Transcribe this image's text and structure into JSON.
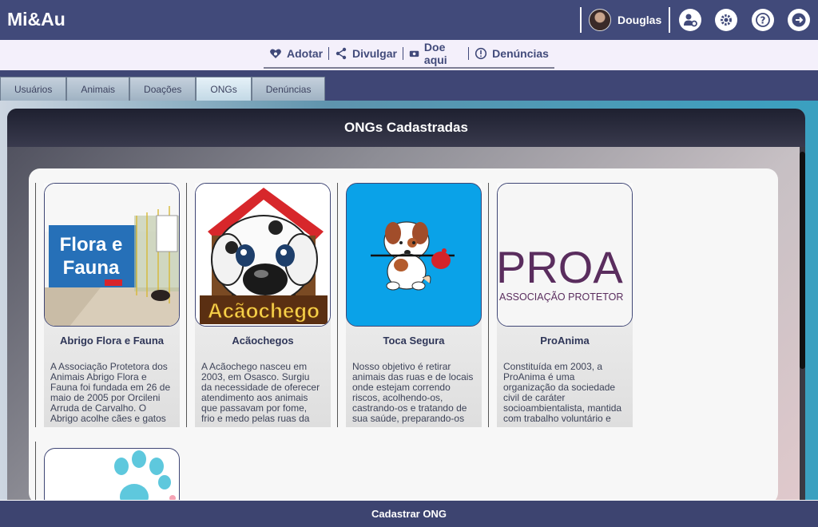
{
  "app": {
    "brand": "Mi&Au"
  },
  "user": {
    "name": "Douglas"
  },
  "header_icons": [
    "user-settings-icon",
    "gear-icon",
    "help-icon",
    "logout-icon"
  ],
  "nav": {
    "items": [
      {
        "label": "Adotar",
        "icon": "heart-paw-icon"
      },
      {
        "label": "Divulgar",
        "icon": "share-icon"
      },
      {
        "label": "Doe aqui",
        "icon": "money-icon"
      },
      {
        "label": "Denúncias",
        "icon": "alert-icon"
      }
    ]
  },
  "tabs": [
    {
      "label": "Usuários"
    },
    {
      "label": "Animais"
    },
    {
      "label": "Doações"
    },
    {
      "label": "ONGs",
      "active": true
    },
    {
      "label": "Denúncias"
    }
  ],
  "panel": {
    "title": "ONGs Cadastradas"
  },
  "ongs": [
    {
      "name": "Abrigo Flora e Fauna",
      "image_text": "Flora e Fauna",
      "description": "A Associação Protetora dos Animais Abrigo Flora e Fauna foi fundada em 26 de maio de 2005 por Orcileni Arruda de Carvalho. O Abrigo acolhe cães e gatos"
    },
    {
      "name": "Acãochegos",
      "image_text": "Acãochego",
      "description": "A Acãochego nasceu em 2003, em Osasco. Surgiu da necessidade de oferecer atendimento aos animais que passavam por fome, frio e medo pelas ruas da"
    },
    {
      "name": "Toca Segura",
      "image_text": "",
      "description": "Nosso objetivo é retirar animais das ruas e de locais onde estejam correndo riscos, acolhendo-os, castrando-os e tratando de sua saúde, preparando-os"
    },
    {
      "name": "ProAnima",
      "image_text": "PROA",
      "image_subtext": "ASSOCIAÇÃO PROTETOR",
      "description": "Constituída em 2003, a ProAnima é uma organização da sociedade civil de caráter socioambientalista, mantida com trabalho voluntário e"
    }
  ],
  "footer": {
    "button_label": "Cadastrar ONG"
  },
  "colors": {
    "header": "#414a7a",
    "nav_bg": "#f4f0fb",
    "toca_blue": "#0aa2e8",
    "proanima_purple": "#5a2d5e"
  }
}
